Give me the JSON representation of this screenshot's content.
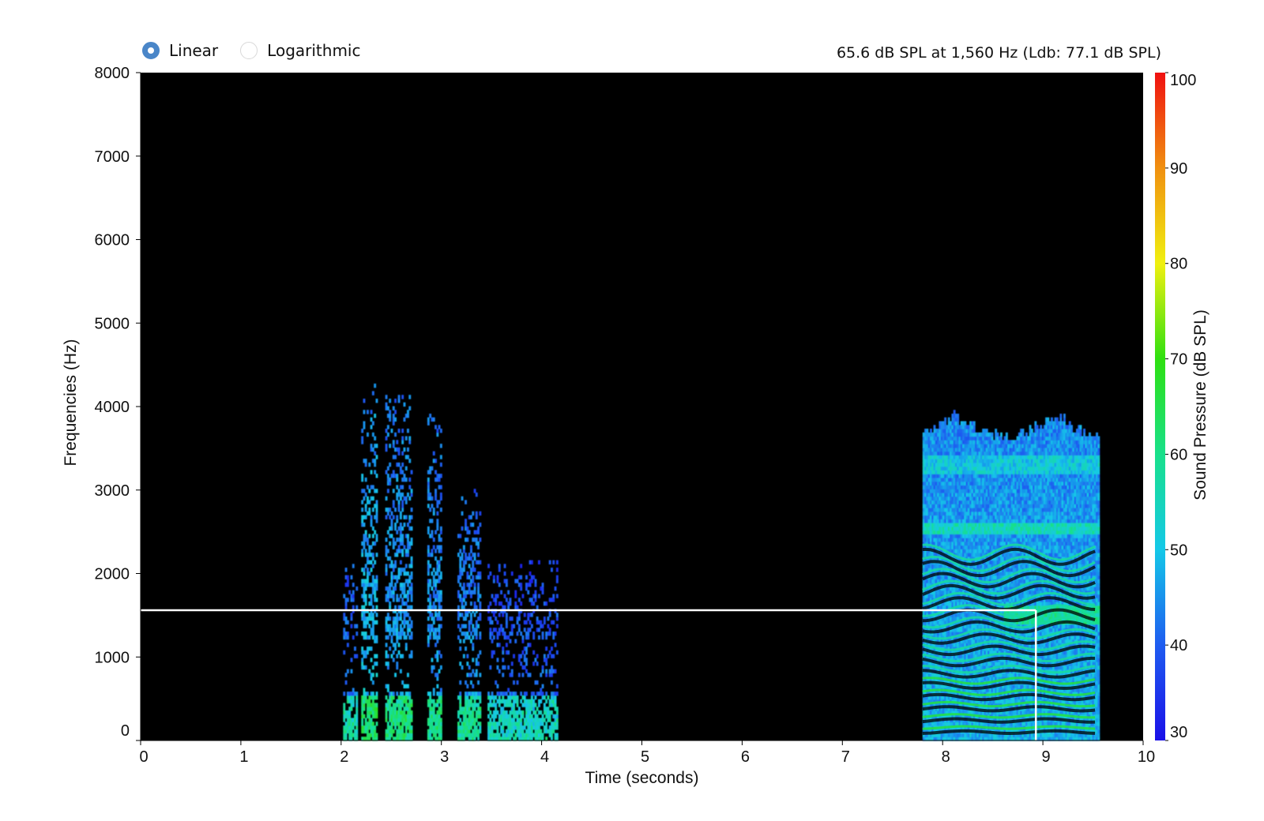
{
  "scale_toggle": {
    "options": [
      {
        "label": "Linear",
        "selected": true
      },
      {
        "label": "Logarithmic",
        "selected": false
      }
    ]
  },
  "readout": {
    "text": "65.6 dB SPL at 1,560 Hz (Ldb: 77.1 dB SPL)"
  },
  "chart_data": {
    "type": "heatmap",
    "xlabel": "Time (seconds)",
    "ylabel": "Frequencies (Hz)",
    "xlim": [
      0,
      10
    ],
    "ylim": [
      0,
      8000
    ],
    "x_ticks": [
      0,
      1,
      2,
      3,
      4,
      5,
      6,
      7,
      8,
      9,
      10
    ],
    "y_ticks": [
      0,
      1000,
      2000,
      3000,
      4000,
      5000,
      6000,
      7000,
      8000
    ],
    "background_color": "#000000",
    "colorbar": {
      "label": "Sound Pressure (dB SPL)",
      "range": [
        30,
        100
      ],
      "ticks": [
        30,
        40,
        50,
        60,
        70,
        80,
        90,
        100
      ],
      "colormap": [
        "#1a10e8",
        "#1e5cf0",
        "#14c8e8",
        "#18e08a",
        "#2ee010",
        "#f0f010",
        "#f09010",
        "#f01010"
      ]
    },
    "cursor": {
      "time": 8.93,
      "frequency": 1560,
      "color": "#ffffff"
    },
    "bursts": [
      {
        "t_start": 2.02,
        "t_end": 2.16,
        "f_max": 2100,
        "level": 44
      },
      {
        "t_start": 2.2,
        "t_end": 2.36,
        "f_max": 4300,
        "level": 50
      },
      {
        "t_start": 2.44,
        "t_end": 2.7,
        "f_max": 4100,
        "level": 48
      },
      {
        "t_start": 2.86,
        "t_end": 3.0,
        "f_max": 3900,
        "level": 47
      },
      {
        "t_start": 3.16,
        "t_end": 3.38,
        "f_max": 3100,
        "level": 46
      },
      {
        "t_start": 3.46,
        "t_end": 4.16,
        "f_max": 2150,
        "level": 42
      }
    ],
    "sustained_regions": [
      {
        "t_start": 7.8,
        "t_end": 9.55,
        "f_max": 3950,
        "level": 52,
        "harmonic_spacing_hz": 140
      }
    ]
  }
}
